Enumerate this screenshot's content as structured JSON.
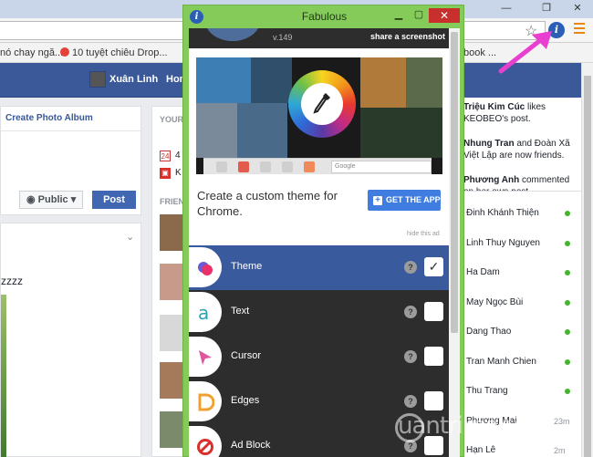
{
  "browser": {
    "bookmarks": [
      "nó chay ngă...",
      "10 tuyệt chiêu Drop...",
      "book ..."
    ],
    "window_controls": [
      "—",
      "❐",
      "✕"
    ]
  },
  "facebook": {
    "user_name": "Xuân Linh",
    "home_link": "Hom",
    "create_album": "Create Photo Album",
    "public_button": "Public",
    "post_button": "Post",
    "feed_text": "zzzz",
    "mid_label": "YOUR",
    "mid_items": [
      {
        "icon": "24",
        "text": "4"
      },
      {
        "icon": "gift",
        "text": "K"
      }
    ],
    "friends_label": "FRIEN",
    "ticker": [
      {
        "name": "Triệu Kim Cúc",
        "text": " likes KEOBEO's post."
      },
      {
        "name": "Nhung Tran",
        "text": " and Đoàn Xã Việt Lập are now friends."
      },
      {
        "name": "Phương Anh",
        "text": " commented on her own post."
      }
    ],
    "chat_contacts": [
      {
        "name": "Đinh Khánh Thiện",
        "time": ""
      },
      {
        "name": "Linh Thuy Nguyen",
        "time": ""
      },
      {
        "name": "Ha Dam",
        "time": ""
      },
      {
        "name": "May Ngọc Bùi",
        "time": ""
      },
      {
        "name": "Dang Thao",
        "time": ""
      },
      {
        "name": "Tran Manh Chien",
        "time": ""
      },
      {
        "name": "Thu Trang",
        "time": ""
      },
      {
        "name": "Phương Mai",
        "time": "23m"
      },
      {
        "name": "Hạn Lê",
        "time": "2m"
      }
    ]
  },
  "popup": {
    "title": "Fabulous",
    "info_glyph": "i",
    "version": "v.149",
    "share": "share a screenshot",
    "ad": {
      "search_placeholder": "Google",
      "headline": "Create a custom theme for Chrome.",
      "get_app": "GET THE APP",
      "hide": "hide this ad"
    },
    "features": [
      {
        "label": "Theme",
        "checked": true,
        "active": true,
        "icon": "theme-icon",
        "color": "#e8306a"
      },
      {
        "label": "Text",
        "checked": false,
        "active": false,
        "icon": "text-icon",
        "color": "#2ba3b5"
      },
      {
        "label": "Cursor",
        "checked": false,
        "active": false,
        "icon": "cursor-icon",
        "color": "#e0569a"
      },
      {
        "label": "Edges",
        "checked": false,
        "active": false,
        "icon": "edges-icon",
        "color": "#f0a030"
      },
      {
        "label": "Ad Block",
        "checked": false,
        "active": false,
        "icon": "ad-block-icon",
        "color": "#d9302c"
      }
    ],
    "help_glyph": "?",
    "check_glyph": "✓"
  },
  "watermark": "uantrimang",
  "colors": {
    "facebook_blue": "#3b5998",
    "popup_frame": "#84cb5a",
    "active_row": "#3a5a9e",
    "annotation_arrow": "#e83fd0"
  }
}
